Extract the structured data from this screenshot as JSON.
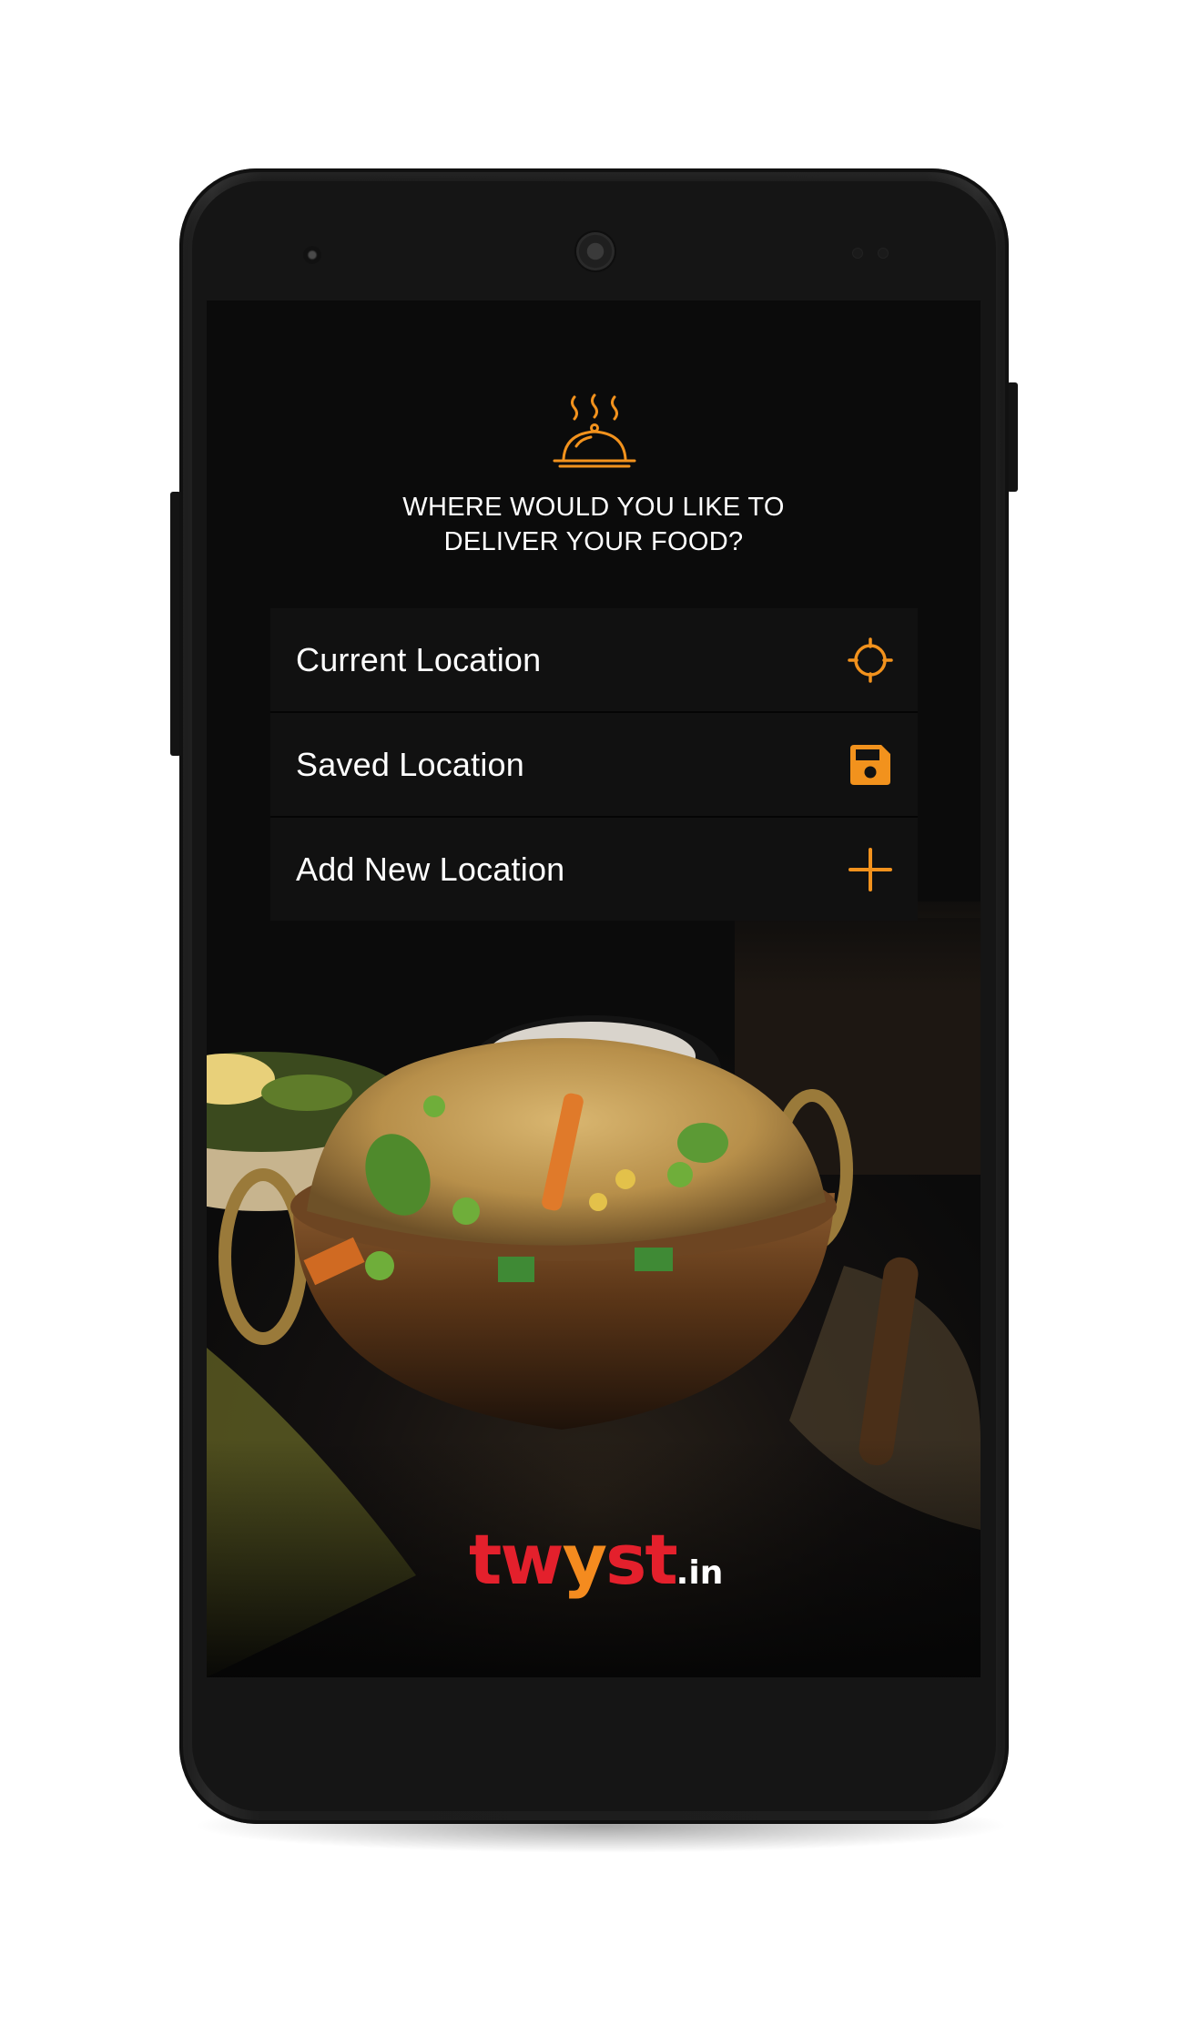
{
  "colors": {
    "accent": "#F2921D",
    "logo_red": "#E4202C",
    "logo_orange": "#F48B1F",
    "screen_bg": "#0B0B0B",
    "option_bg": "#121212",
    "text": "#FFFFFF"
  },
  "header": {
    "icon": "cloche-icon",
    "title_line1": "WHERE WOULD YOU LIKE TO",
    "title_line2": "DELIVER YOUR FOOD?"
  },
  "options": [
    {
      "label": "Current Location",
      "icon": "crosshair-icon"
    },
    {
      "label": "Saved Location",
      "icon": "save-icon"
    },
    {
      "label": "Add New Location",
      "icon": "plus-icon"
    }
  ],
  "brand": {
    "name_part1": "tw",
    "name_part2": "y",
    "name_part3": "st",
    "tld": ".in"
  }
}
